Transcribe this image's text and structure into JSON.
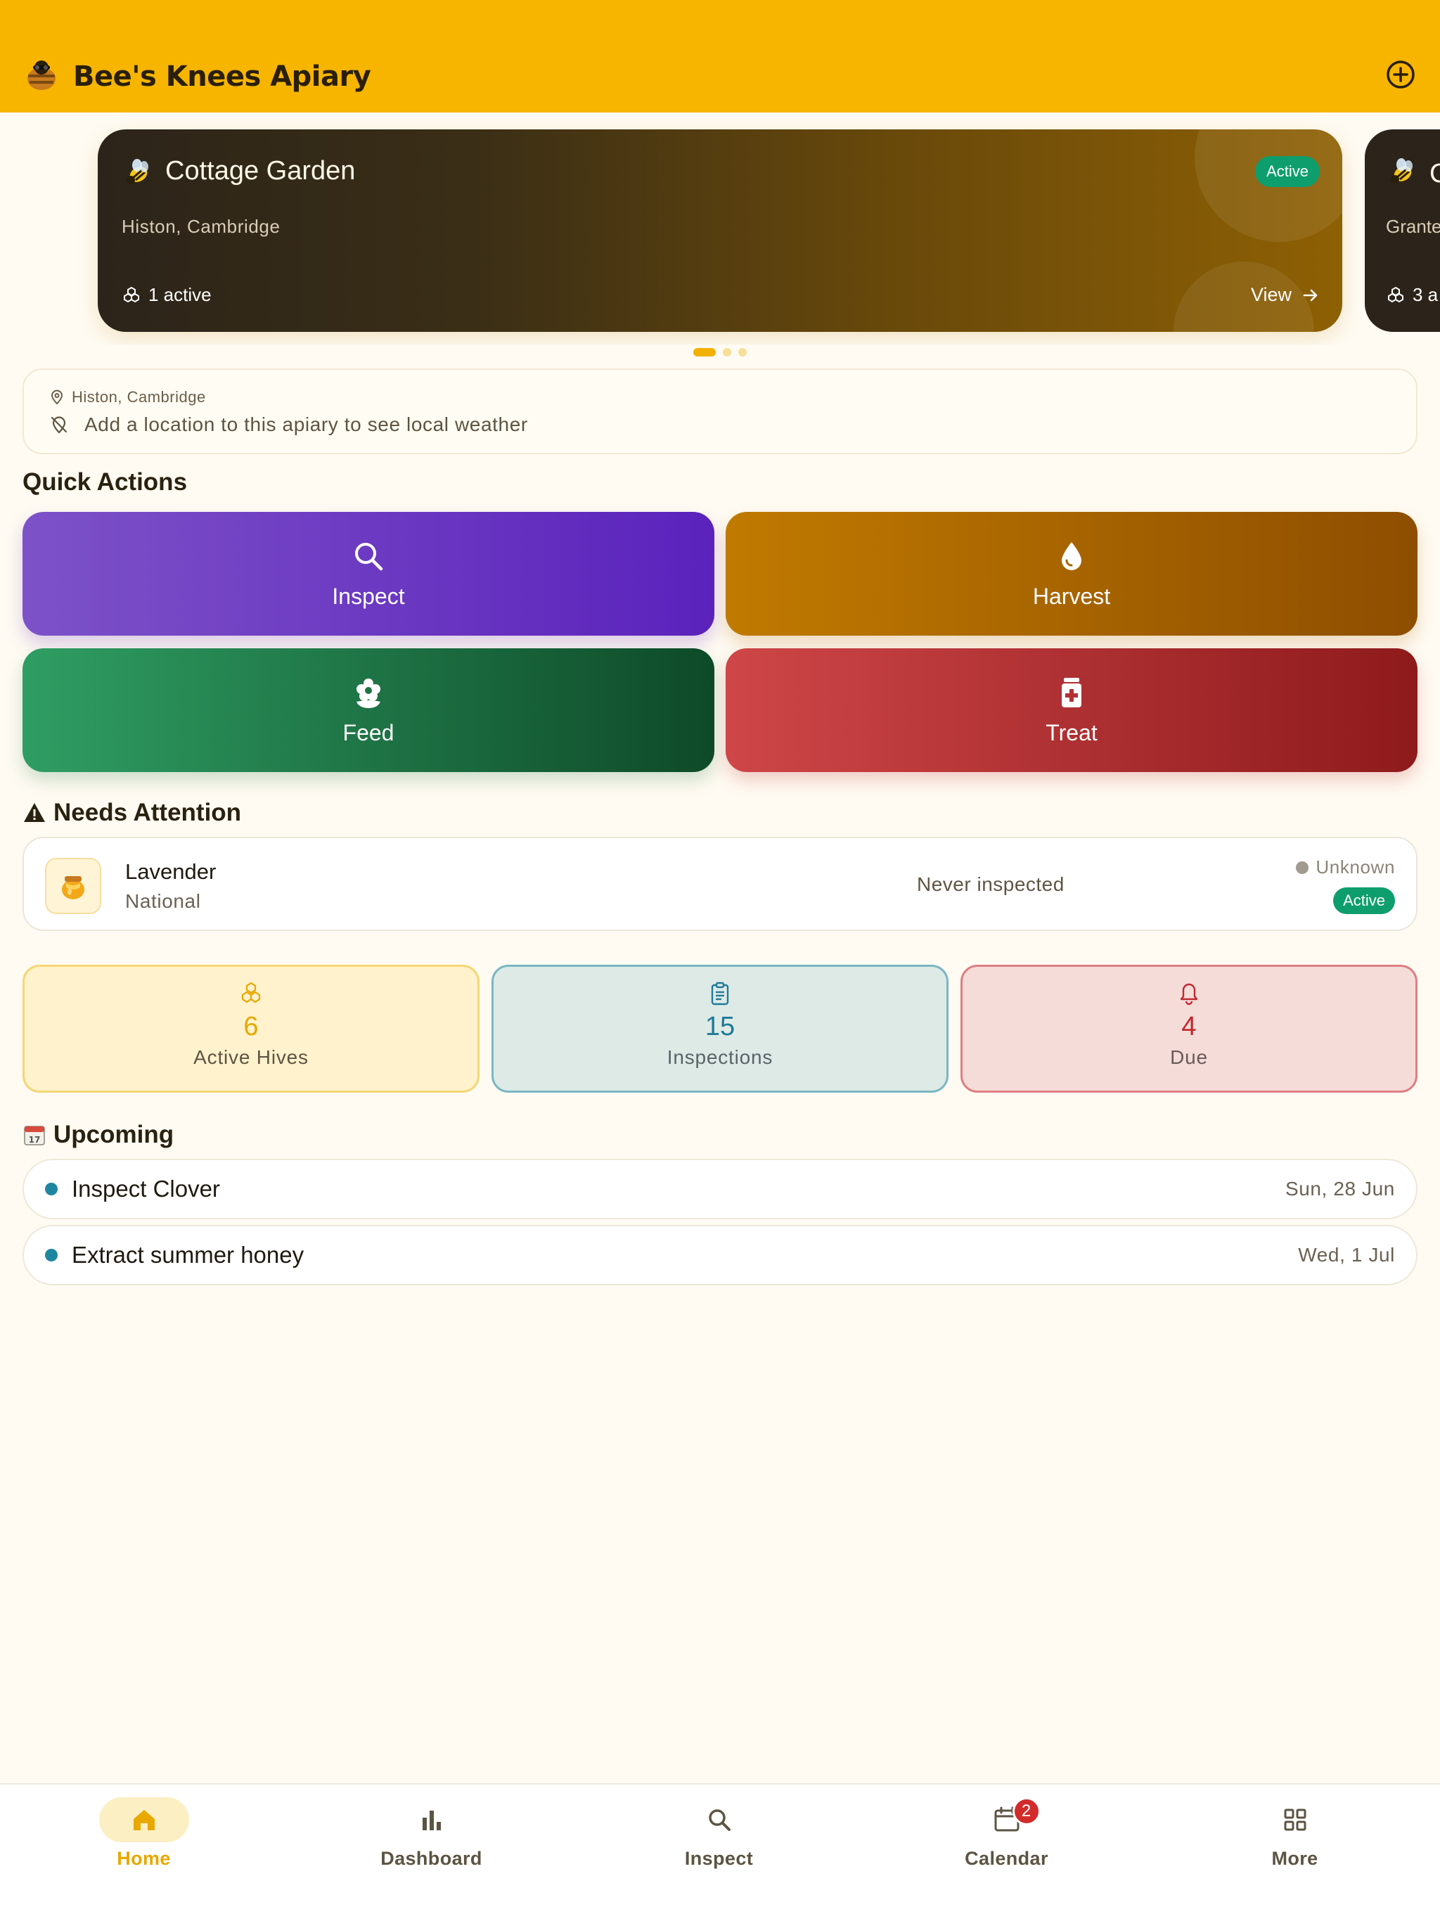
{
  "header": {
    "title": "Bee's Knees Apiary",
    "logo_icon": "bee-hive-icon",
    "add_icon": "plus-circle-icon",
    "color": "#F7B500"
  },
  "carousel": {
    "cards": [
      {
        "name": "Cottage Garden",
        "location": "Histon, Cambridge",
        "status": "Active",
        "hive_count": "1 active",
        "view_label": "View"
      },
      {
        "name": "C",
        "location": "Grante",
        "hive_count": "3 a"
      }
    ],
    "pages": 3,
    "active_page": 1
  },
  "weather": {
    "location": "Histon, Cambridge",
    "message": "Add a location to this apiary to see local weather"
  },
  "quick_actions": {
    "title": "Quick Actions",
    "items": [
      {
        "label": "Inspect",
        "icon": "search-icon",
        "color": "#6A35C4"
      },
      {
        "label": "Harvest",
        "icon": "drop-icon",
        "color": "#A86400"
      },
      {
        "label": "Feed",
        "icon": "flower-icon",
        "color": "#1E7444"
      },
      {
        "label": "Treat",
        "icon": "medicine-icon",
        "color": "#B23034"
      }
    ]
  },
  "attention": {
    "title": "Needs Attention",
    "hive": {
      "name": "Lavender",
      "type": "National",
      "inspection_status": "Never inspected",
      "health": "Unknown",
      "status": "Active"
    }
  },
  "stats": [
    {
      "value": "6",
      "label": "Active Hives",
      "icon": "hexagon-icon"
    },
    {
      "value": "15",
      "label": "Inspections",
      "icon": "clipboard-icon"
    },
    {
      "value": "4",
      "label": "Due",
      "icon": "bell-icon"
    }
  ],
  "upcoming": {
    "title": "Upcoming",
    "events": [
      {
        "title": "Inspect Clover",
        "date": "Sun, 28 Jun"
      },
      {
        "title": "Extract summer honey",
        "date": "Wed, 1 Jul"
      }
    ]
  },
  "bottom_nav": {
    "items": [
      {
        "label": "Home",
        "icon": "home-icon",
        "active": true
      },
      {
        "label": "Dashboard",
        "icon": "bar-chart-icon"
      },
      {
        "label": "Inspect",
        "icon": "search-icon"
      },
      {
        "label": "Calendar",
        "icon": "calendar-icon",
        "badge": "2"
      },
      {
        "label": "More",
        "icon": "grid-icon"
      }
    ]
  }
}
